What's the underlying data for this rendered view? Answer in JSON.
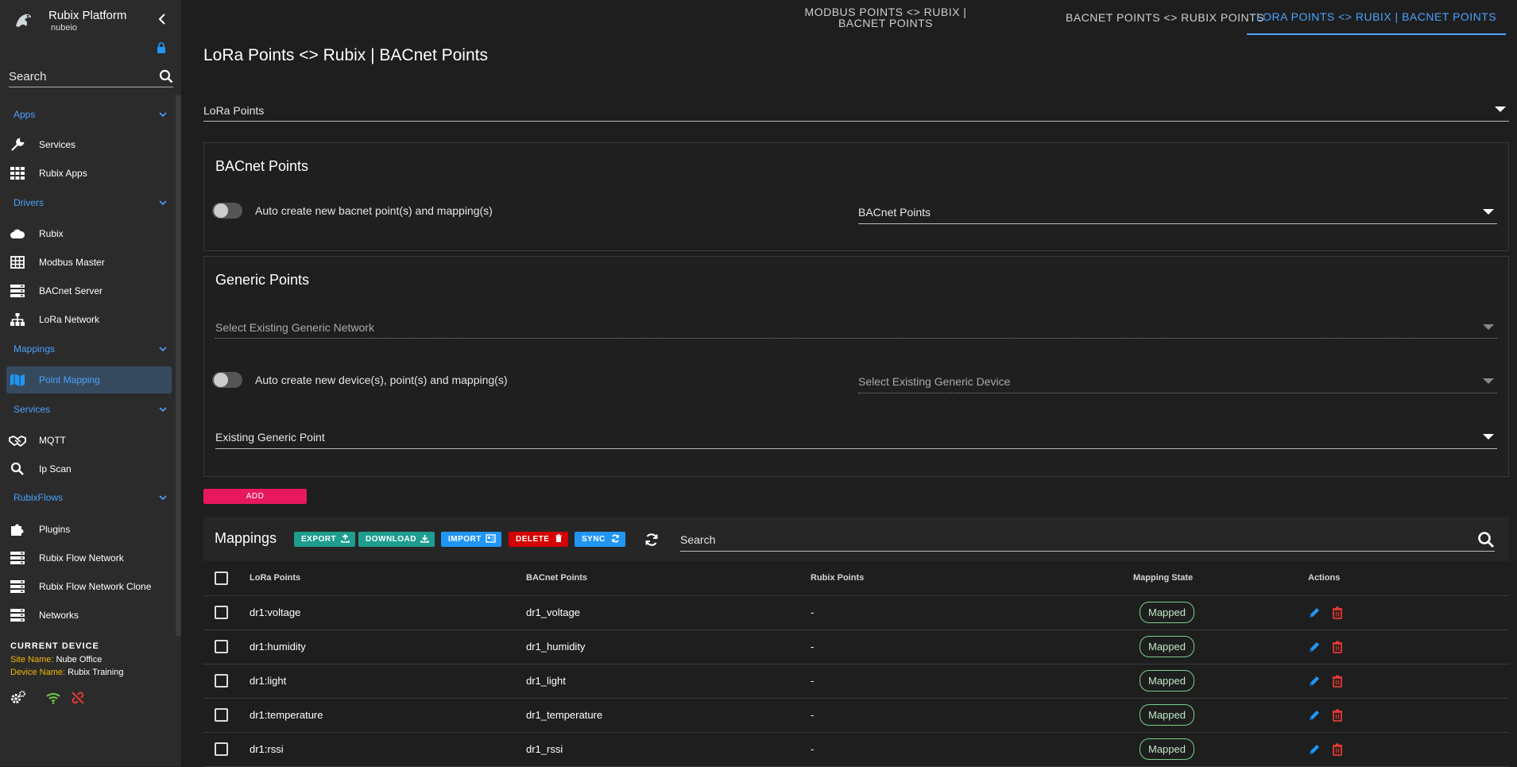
{
  "brand": {
    "title": "Rubix Platform",
    "subtitle": "nubeio"
  },
  "sidebar": {
    "search_label": "Search",
    "groups": [
      {
        "label": "Apps"
      },
      {
        "label": "Drivers"
      },
      {
        "label": "Mappings"
      },
      {
        "label": "Services"
      },
      {
        "label": "RubixFlows"
      }
    ],
    "items": [
      {
        "label": "Services",
        "icon": "wrench-icon"
      },
      {
        "label": "Rubix Apps",
        "icon": "apps-grid-icon"
      },
      {
        "label": "Rubix",
        "icon": "cloud-icon"
      },
      {
        "label": "Modbus Master",
        "icon": "table-icon"
      },
      {
        "label": "BACnet Server",
        "icon": "server-icon"
      },
      {
        "label": "LoRa Network",
        "icon": "network-icon"
      },
      {
        "label": "Point Mapping",
        "icon": "map-icon"
      },
      {
        "label": "MQTT",
        "icon": "handshake-icon"
      },
      {
        "label": "Ip Scan",
        "icon": "search-icon"
      },
      {
        "label": "Plugins",
        "icon": "puzzle-icon"
      },
      {
        "label": "Rubix Flow Network",
        "icon": "server-icon"
      },
      {
        "label": "Rubix Flow Network Clone",
        "icon": "server-icon"
      },
      {
        "label": "Networks",
        "icon": "server-icon"
      }
    ],
    "current_device": {
      "heading": "CURRENT DEVICE",
      "site_key": "Site Name:",
      "site_value": "Nube Office",
      "device_key": "Device Name:",
      "device_value": "Rubix Training"
    }
  },
  "tabs": [
    {
      "label": "MODBUS POINTS <> RUBIX | BACNET POINTS"
    },
    {
      "label": "BACNET POINTS <> RUBIX POINTS"
    },
    {
      "label": "LORA POINTS <> RUBIX | BACNET POINTS"
    }
  ],
  "page": {
    "title": "LoRa Points <> Rubix | BACnet Points",
    "lora_select": "LoRa Points"
  },
  "bacnet_panel": {
    "title": "BACnet Points",
    "toggle_label": "Auto create new bacnet point(s) and mapping(s)",
    "select": "BACnet Points"
  },
  "generic_panel": {
    "title": "Generic Points",
    "network_select": "Select Existing Generic Network",
    "toggle_label": "Auto create new device(s), point(s) and mapping(s)",
    "device_select": "Select Existing Generic Device",
    "point_select": "Existing Generic Point"
  },
  "add_label": "ADD",
  "mappings": {
    "title": "Mappings",
    "buttons": {
      "export": "EXPORT",
      "download": "DOWNLOAD",
      "import": "IMPORT",
      "delete": "DELETE",
      "sync": "SYNC"
    },
    "search_label": "Search",
    "columns": [
      "LoRa Points",
      "BACnet Points",
      "Rubix Points",
      "Mapping State",
      "Actions"
    ],
    "rows": [
      [
        "dr1:voltage",
        "dr1_voltage",
        "-",
        "Mapped"
      ],
      [
        "dr1:humidity",
        "dr1_humidity",
        "-",
        "Mapped"
      ],
      [
        "dr1:light",
        "dr1_light",
        "-",
        "Mapped"
      ],
      [
        "dr1:temperature",
        "dr1_temperature",
        "-",
        "Mapped"
      ],
      [
        "dr1:rssi",
        "dr1_rssi",
        "-",
        "Mapped"
      ]
    ]
  },
  "colors": {
    "accent": "#4aa3ff",
    "add": "#e8185d",
    "export": "#1e9e8e",
    "import": "#2196f3",
    "delete": "#d50000",
    "mapped": "#7ad08a",
    "status_ok": "#6fcf3f",
    "status_err": "#e53935"
  }
}
